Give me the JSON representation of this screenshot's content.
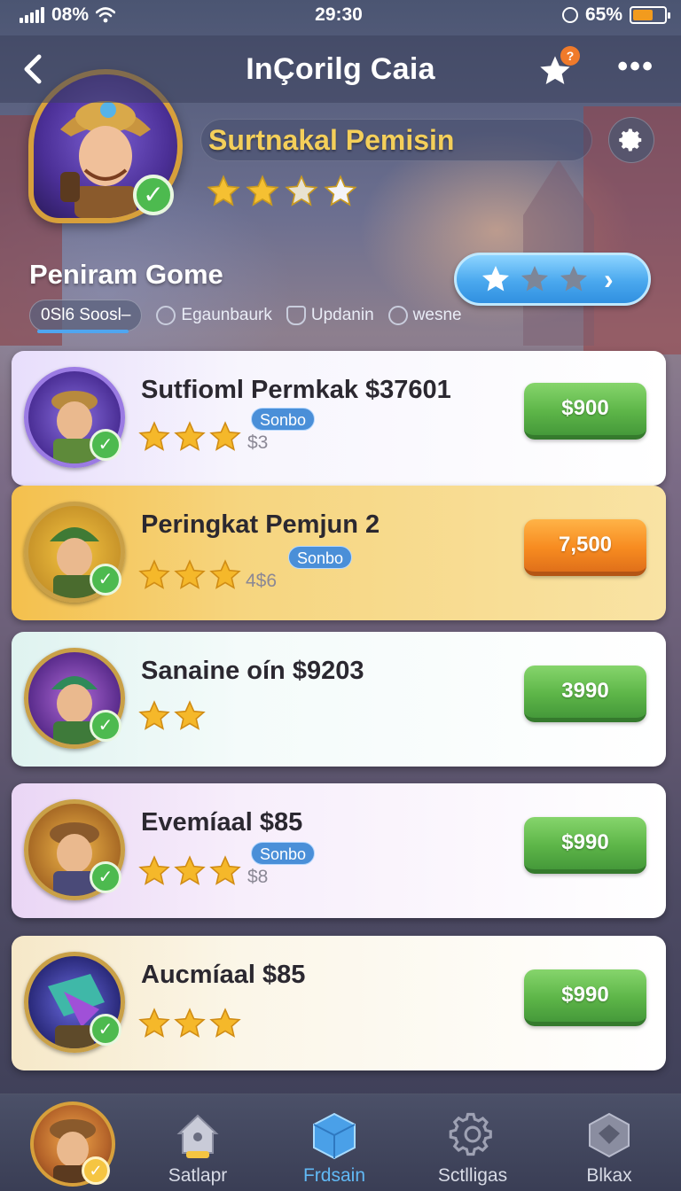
{
  "status_bar": {
    "signal_label": "08%",
    "time": "29:30",
    "battery_label": "65%",
    "battery_level": 0.65
  },
  "header": {
    "title": "InÇorilg Caia",
    "back_icon": "chevron-left-icon",
    "favorite_badge": "?",
    "more_label": "•••"
  },
  "hero": {
    "name": "Surtnakal Pemisin",
    "rating": 2.5,
    "rating_max": 4
  },
  "section": {
    "title": "Peniram Gome",
    "rate_button": {
      "filled": 1,
      "total": 3
    }
  },
  "filters": [
    {
      "label": "0Sl6 Soosl–",
      "icon": "",
      "active": true
    },
    {
      "label": "Egaunbaurk",
      "icon": "coin-icon",
      "active": false
    },
    {
      "label": "Updanin",
      "icon": "shield-icon",
      "active": false
    },
    {
      "label": "wesne",
      "icon": "leaf-icon",
      "active": false
    }
  ],
  "items": [
    {
      "title": "Sutfioml Permkak $37601",
      "stars": 3,
      "tag": "Sonbo",
      "sub": "$3",
      "price": "$900",
      "button_color": "green",
      "theme": "lavender"
    },
    {
      "title": "Peringkat Pemjun 2",
      "stars": 3,
      "tag": "Sonbo",
      "sub": "4$6",
      "price": "7,500",
      "button_color": "orange",
      "theme": "gold"
    },
    {
      "title": "Sanaine oín $9203",
      "stars": 2,
      "tag": "",
      "sub": "",
      "price": "3990",
      "button_color": "green",
      "theme": "mint"
    },
    {
      "title": "Evemíaal $85",
      "stars": 3,
      "tag": "Sonbo",
      "sub": "$8",
      "price": "$990",
      "button_color": "green",
      "theme": "pink"
    },
    {
      "title": "Aucmíaal $85",
      "stars": 3,
      "tag": "",
      "sub": "",
      "price": "$990",
      "button_color": "green",
      "theme": "cream"
    }
  ],
  "bottom_nav": [
    {
      "label": "",
      "icon": "profile-avatar"
    },
    {
      "label": "Satlapr",
      "icon": "house-icon"
    },
    {
      "label": "Frdsain",
      "icon": "cube-icon",
      "active": true
    },
    {
      "label": "Sctlligas",
      "icon": "gear-icon"
    },
    {
      "label": "Blkax",
      "icon": "box-icon"
    }
  ],
  "colors": {
    "accent_blue": "#4aa8ee",
    "gold_text": "#f4cf5a",
    "buy_green": "#5db548",
    "buy_orange": "#f78b20",
    "check_green": "#4dba4f"
  }
}
